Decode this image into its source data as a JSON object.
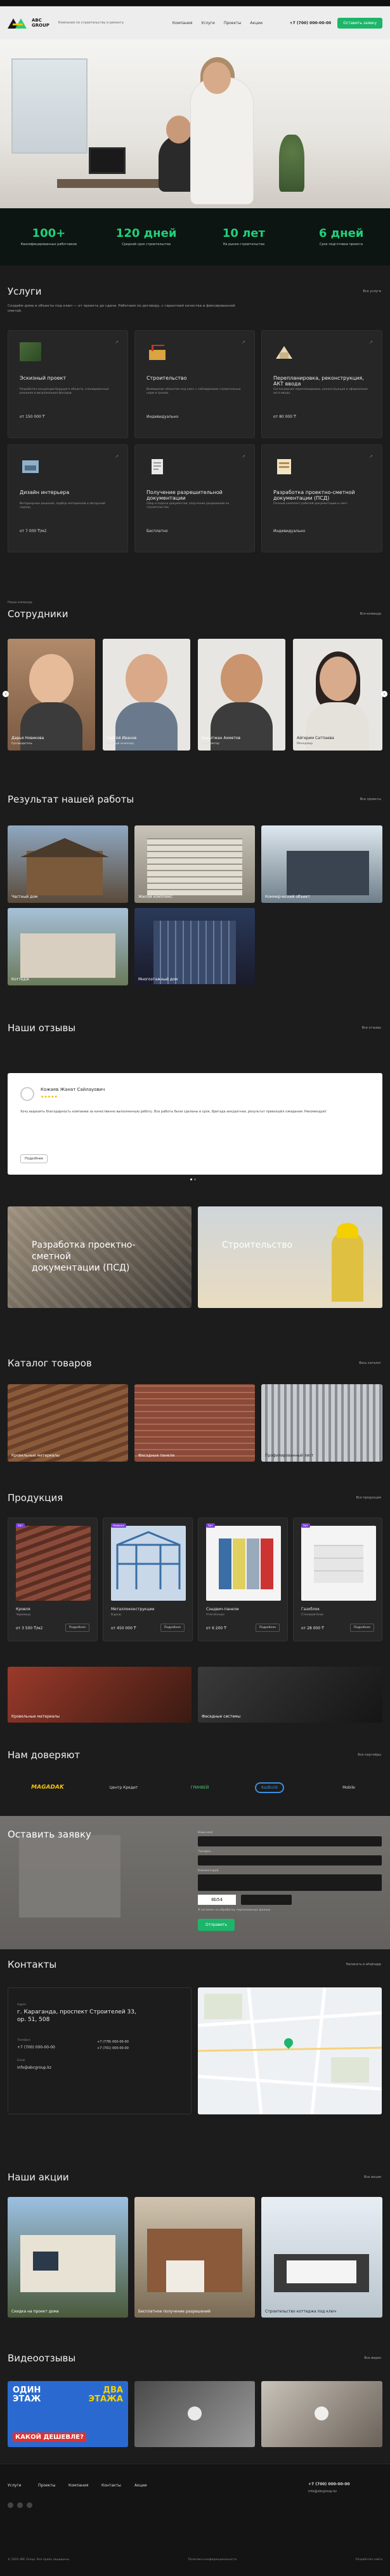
{
  "header": {
    "brand_line1": "ABC",
    "brand_line2": "GROUP",
    "tagline": "Компания по строительству и ремонту",
    "nav": [
      "Компания",
      "Услуги",
      "Проекты",
      "Акции"
    ],
    "phone": "+7 (700) 000-00-00",
    "cta": "Оставить заявку"
  },
  "stats": [
    {
      "value": "100+",
      "label": "Квалифицированных работников"
    },
    {
      "value": "120 дней",
      "label": "Средний срок строительства"
    },
    {
      "value": "10 лет",
      "label": "На рынке строительства"
    },
    {
      "value": "6 дней",
      "label": "Срок подготовки проекта"
    }
  ],
  "services": {
    "title": "Услуги",
    "link": "Все услуги",
    "desc": "Создаём дома и объекты под ключ — от проекта до сдачи. Работаем по договору, с гарантией качества и фиксированной сметой.",
    "items": [
      {
        "title": "Эскизный проект",
        "desc": "Разработка концепции будущего объекта, планировочные решения и визуализация фасадов.",
        "price": "от 150 000 ₸"
      },
      {
        "title": "Строительство",
        "desc": "Возведение объектов под ключ с соблюдением строительных норм и сроков.",
        "price": "Индивидуально"
      },
      {
        "title": "Перепланировка, реконструкция, АКТ ввода",
        "desc": "Согласование перепланировки, реконструкция и оформление акта ввода.",
        "price": "от 80 000 ₸"
      },
      {
        "title": "Дизайн интерьера",
        "desc": "Интерьерные решения, подбор материалов и авторский надзор.",
        "price": "от 7 000 ₸/м2"
      },
      {
        "title": "Получение разрешительной документации",
        "desc": "Сбор и подача документов, получение разрешений на строительство.",
        "price": "Бесплатно"
      },
      {
        "title": "Разработка проектно-сметной документации (ПСД)",
        "desc": "Полный комплект рабочей документации и смет.",
        "price": "Индивидуально"
      }
    ]
  },
  "team": {
    "small": "Наша команда",
    "title": "Сотрудники",
    "link": "Вся команда",
    "members": [
      {
        "name": "Дарья Новикова",
        "role": "Руководитель"
      },
      {
        "name": "Сергей Иванов",
        "role": "Главный инженер"
      },
      {
        "name": "Бахытжан Ахметов",
        "role": "Архитектор"
      },
      {
        "name": "Айгерим Сатпаева",
        "role": "Менеджер"
      }
    ]
  },
  "results": {
    "title": "Результат нашей работы",
    "link": "Все проекты",
    "items": [
      "Частный дом",
      "Жилой комплекс",
      "Коммерческий объект",
      "Коттедж",
      "Многоэтажный дом"
    ]
  },
  "reviews": {
    "title": "Наши отзывы",
    "link": "Все отзывы",
    "name": "Кожаев Жанат Сайлауович",
    "stars": "★★★★★",
    "text": "Хочу выразить благодарность компании за качественно выполненную работу. Все работы были сделаны в срок, бригада аккуратная, результат превзошёл ожидания. Рекомендую!",
    "more": "Подробнее"
  },
  "banners": [
    {
      "title": "Разработка проектно-сметной документации (ПСД)"
    },
    {
      "title": "Строительство"
    }
  ],
  "catalog": {
    "title": "Каталог товаров",
    "link": "Весь каталог",
    "items": [
      "Кровельные материалы",
      "Фасадные панели",
      "Профилированный лист"
    ]
  },
  "products": {
    "title": "Продукция",
    "link": "Вся продукция",
    "items": [
      {
        "badge": "Хит",
        "title": "Кровля",
        "sub": "Черепица",
        "price": "от 3 500 ₸/м2",
        "btn": "Подробнее"
      },
      {
        "badge": "Новинка",
        "title": "Металлоконструкции",
        "sub": "Каркас",
        "price": "от 450 000 ₸",
        "btn": "Подробнее"
      },
      {
        "badge": "Хит",
        "title": "Сэндвич-панели",
        "sub": "Утеплённые",
        "price": "от 6 200 ₸",
        "btn": "Подробнее"
      },
      {
        "badge": "Хит",
        "title": "Газоблок",
        "sub": "Стеновой блок",
        "price": "от 28 000 ₸",
        "btn": "Подробнее"
      }
    ],
    "banners": [
      "Кровельные материалы",
      "Фасадные системы"
    ]
  },
  "partners": {
    "title": "Нам доверяют",
    "link": "Все партнёры",
    "items": [
      "MAGADAK",
      "Центр Кредит",
      "ГРИНВЕЙ",
      "KazBuild",
      "Mobile"
    ]
  },
  "form": {
    "title": "Оставить заявку",
    "name_label": "Ваше имя",
    "phone_label": "Телефон",
    "comment_label": "Комментарий",
    "captcha": "8b54",
    "submit": "Отправить",
    "consent": "Я согласен на обработку персональных данных"
  },
  "contacts": {
    "title": "Контакты",
    "link": "Написать в whatsapp",
    "address_label": "Адрес",
    "address": "г. Караганда, проспект Строителей 33, ор. 51, 508",
    "phone_label": "Телефон",
    "phones": [
      "+7 (700) 000-00-00",
      "+7 (778) 000-00-00",
      "+7 (701) 000-00-00"
    ],
    "email_label": "Email",
    "email": "info@abcgroup.kz"
  },
  "promos": {
    "title": "Наши акции",
    "link": "Все акции",
    "items": [
      "Скидка на проект дома",
      "Бесплатное получение разрешений",
      "Строительство коттеджа под ключ"
    ]
  },
  "videos": {
    "title": "Видеоотзывы",
    "link": "Все видео",
    "v1_line1": "ОДИН",
    "v1_line2": "ЭТАЖ",
    "v1_line3": "КАКОЙ ДЕШЕВЛЕ?",
    "v1_right1": "ДВА",
    "v1_right2": "ЭТАЖА"
  },
  "footer": {
    "nav": [
      "Услуги",
      "Проекты",
      "Компания",
      "Контакты",
      "Акции"
    ],
    "phone": "+7 (700) 000-00-00",
    "email": "info@abcgroup.kz",
    "copyright": "© 2024 ABC Group. Все права защищены",
    "policy": "Политика конфиденциальности",
    "dev": "Разработка сайта"
  },
  "colors": {
    "accent": "#1db56a",
    "bg": "#1c1c1c"
  }
}
